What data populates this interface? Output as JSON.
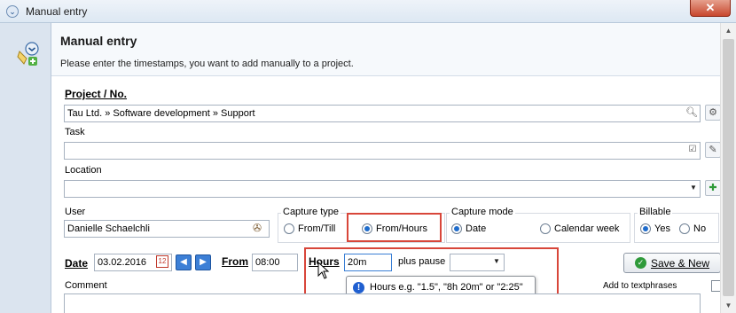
{
  "window": {
    "title": "Manual entry",
    "close_glyph": "✕"
  },
  "header": {
    "title": "Manual entry",
    "subtitle": "Please enter the timestamps, you want to add manually to a project."
  },
  "project": {
    "label": "Project / No.",
    "value": "Tau Ltd. » Software development » Support"
  },
  "task": {
    "label": "Task",
    "value": ""
  },
  "location": {
    "label": "Location",
    "value": ""
  },
  "user": {
    "label": "User",
    "value": "Danielle Schaelchli"
  },
  "capture_type": {
    "title": "Capture type",
    "options": [
      "From/Till",
      "From/Hours"
    ],
    "selected": "From/Hours"
  },
  "capture_mode": {
    "title": "Capture mode",
    "options": [
      "Date",
      "Calendar week"
    ],
    "selected": "Date"
  },
  "billable": {
    "title": "Billable",
    "options": [
      "Yes",
      "No"
    ],
    "selected": "Yes"
  },
  "date": {
    "label": "Date",
    "value": "03.02.2016"
  },
  "from": {
    "label": "From",
    "value": "08:00"
  },
  "hours": {
    "label": "Hours",
    "value": "20m"
  },
  "pause": {
    "label": "plus pause",
    "value": ""
  },
  "save_button": {
    "label": "Save & New"
  },
  "comment": {
    "label": "Comment",
    "value": ""
  },
  "textphrases": {
    "label": "Add to textphrases",
    "checked": false
  },
  "tooltip": {
    "text": "Hours e.g. \"1.5\", \"8h 20m\" or \"2:25\""
  },
  "colors": {
    "accent": "#1f6ccc",
    "highlight": "#d8463a",
    "save_green": "#2f9a3a"
  },
  "icons": [
    "app-chevron-icon",
    "manual-entry-icon",
    "project-search-icon",
    "project-settings-icon",
    "task-select-icon",
    "task-edit-icon",
    "location-dropdown-icon",
    "location-pin-icon",
    "user-picker-icon",
    "calendar-icon",
    "prev-day-icon",
    "next-day-icon",
    "pause-dropdown-icon",
    "save-check-icon",
    "info-icon",
    "mouse-cursor-icon"
  ]
}
